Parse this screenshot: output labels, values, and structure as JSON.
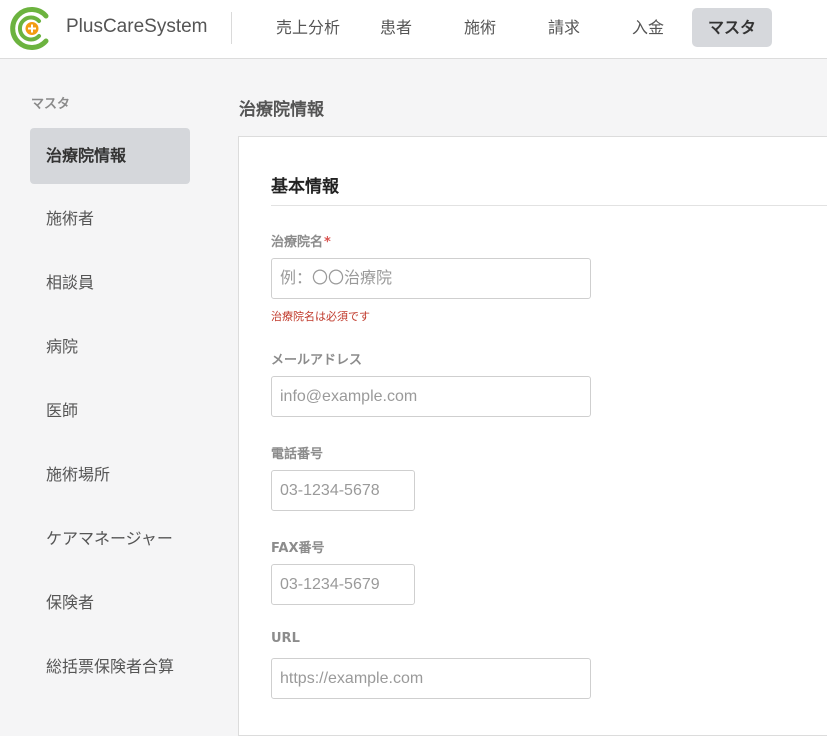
{
  "header": {
    "brand": "PlusCareSystem",
    "nav": [
      "売上分析",
      "患者",
      "施術",
      "請求",
      "入金",
      "マスタ"
    ],
    "active_nav": "マスタ"
  },
  "sidebar": {
    "title": "マスタ",
    "items": [
      "治療院情報",
      "施術者",
      "相談員",
      "病院",
      "医師",
      "施術場所",
      "ケアマネージャー",
      "保険者",
      "総括票保険者合算"
    ],
    "active_item": "治療院情報"
  },
  "main": {
    "page_title": "治療院情報",
    "section_title": "基本情報",
    "fields": {
      "clinic_name": {
        "label": "治療院名",
        "required_mark": "*",
        "placeholder": "例：〇〇治療院",
        "value": "",
        "error": "治療院名は必須です"
      },
      "email": {
        "label": "メールアドレス",
        "placeholder": "info@example.com",
        "value": ""
      },
      "phone": {
        "label": "電話番号",
        "placeholder": "03-1234-5678",
        "value": ""
      },
      "fax": {
        "label": "FAX番号",
        "placeholder": "03-1234-5679",
        "value": ""
      },
      "url": {
        "label": "URL",
        "placeholder": "https://example.com",
        "value": ""
      }
    }
  },
  "colors": {
    "logo_green": "#6cb33f",
    "logo_orange": "#f39c12",
    "error_red": "#c0392b",
    "active_bg": "#d6d8dc"
  },
  "icons": {
    "logo": "plus-care-logo-icon"
  }
}
